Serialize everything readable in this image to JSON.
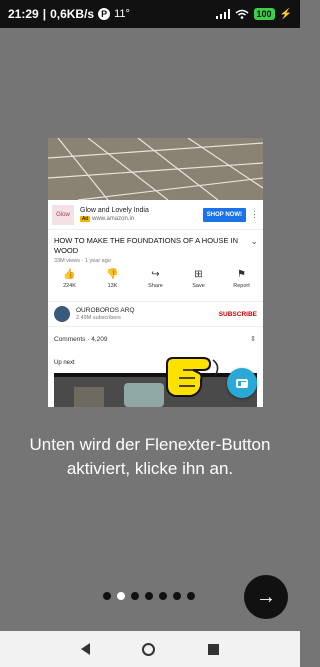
{
  "status_bar": {
    "time": "21:29",
    "speed": "0,6KB/s",
    "app_badge": "P",
    "temperature": "11°",
    "battery": "100"
  },
  "video_card": {
    "ad": {
      "logo_text": "Glow",
      "title": "Glow and Lovely India",
      "ad_badge": "Ad",
      "url": "www.amazon.in",
      "cta": "SHOP NOW!"
    },
    "title": "HOW TO MAKE THE FOUNDATIONS OF A HOUSE IN WOOD",
    "meta": "33M views · 1 year ago",
    "actions": [
      {
        "icon": "thumbs-up-icon",
        "label": "224K"
      },
      {
        "icon": "thumbs-down-icon",
        "label": "13K"
      },
      {
        "icon": "share-icon",
        "label": "Share"
      },
      {
        "icon": "save-icon",
        "label": "Save"
      },
      {
        "icon": "report-icon",
        "label": "Report"
      }
    ],
    "channel": {
      "name": "OUROBOROS ARQ",
      "subscribers": "2.49M subscribers",
      "subscribe_label": "SUBSCRIBE"
    },
    "comments_label": "Comments · 4,209",
    "up_next_label": "Up next"
  },
  "instruction": "Unten wird der Flenexter-Button aktiviert, klicke ihn an.",
  "pager": {
    "total": 7,
    "active_index": 1
  },
  "colors": {
    "background": "#757575",
    "fab": "#2aa9d6",
    "shop_button": "#1a73e8",
    "subscribe": "#cc0000",
    "hand": "#ffe100"
  }
}
